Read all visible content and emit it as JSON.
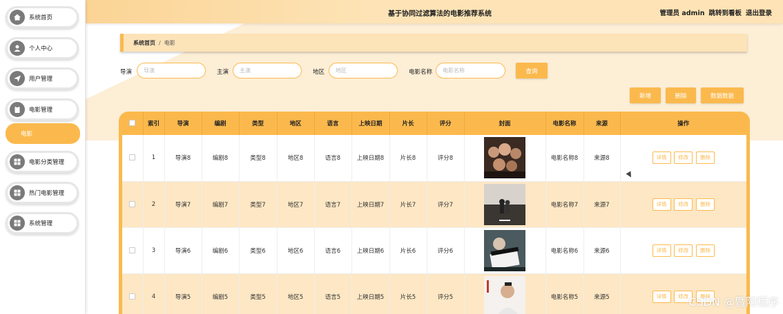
{
  "header": {
    "title": "基于协同过滤算法的电影推荐系统",
    "user": "管理员 admin",
    "dashboard_link": "跳转到看板",
    "logout_link": "退出登录"
  },
  "sidebar": {
    "items": [
      {
        "label": "系统首页",
        "icon": "home-icon"
      },
      {
        "label": "个人中心",
        "icon": "user-icon"
      },
      {
        "label": "用户管理",
        "icon": "send-icon"
      },
      {
        "label": "电影管理",
        "icon": "clipboard-icon"
      },
      {
        "label": "电影分类管理",
        "icon": "grid-icon"
      },
      {
        "label": "热门电影管理",
        "icon": "grid-icon"
      },
      {
        "label": "系统管理",
        "icon": "grid-icon"
      }
    ],
    "active_sub": "电影"
  },
  "breadcrumb": {
    "home": "系统首页",
    "separator": "/",
    "current": "电影"
  },
  "search": {
    "director_label": "导演",
    "director_placeholder": "导演",
    "actor_label": "主演",
    "actor_placeholder": "主演",
    "region_label": "地区",
    "region_placeholder": "地区",
    "name_label": "电影名称",
    "name_placeholder": "电影名称",
    "query_button": "查询"
  },
  "actions": {
    "add": "新增",
    "delete": "删除",
    "export": "数据数据"
  },
  "table": {
    "headers": [
      "",
      "索引",
      "导演",
      "编剧",
      "类型",
      "地区",
      "语言",
      "上映日期",
      "片长",
      "评分",
      "封面",
      "电影名称",
      "来源",
      "操作"
    ],
    "rows": [
      {
        "index": "1",
        "director": "导演8",
        "writer": "编剧8",
        "type": "类型8",
        "region": "地区8",
        "language": "语言8",
        "release": "上映日期8",
        "length": "片长8",
        "rating": "评分8",
        "name": "电影名称8",
        "source": "来源8",
        "cover": "cover-photo-group"
      },
      {
        "index": "2",
        "director": "导演7",
        "writer": "编剧7",
        "type": "类型7",
        "region": "地区7",
        "language": "语言7",
        "release": "上映日期7",
        "length": "片长7",
        "rating": "评分7",
        "name": "电影名称7",
        "source": "来源7",
        "cover": "cover-poster-couple"
      },
      {
        "index": "3",
        "director": "导演6",
        "writer": "编剧6",
        "type": "类型6",
        "region": "地区6",
        "language": "语言6",
        "release": "上映日期6",
        "length": "片长6",
        "rating": "评分6",
        "name": "电影名称6",
        "source": "来源6",
        "cover": "cover-clapperboard"
      },
      {
        "index": "4",
        "director": "导演5",
        "writer": "编剧5",
        "type": "类型5",
        "region": "地区5",
        "language": "语言5",
        "release": "上映日期5",
        "length": "片长5",
        "rating": "评分5",
        "name": "电影名称5",
        "source": "来源5",
        "cover": "cover-portrait"
      }
    ],
    "op_detail": "详情",
    "op_edit": "修改",
    "op_delete": "删除"
  },
  "watermark": "CSDN @暨阳程序",
  "colors": {
    "accent": "#fbb94d",
    "header_bg": "#fde3b5",
    "row_alt": "#fde7c4"
  }
}
